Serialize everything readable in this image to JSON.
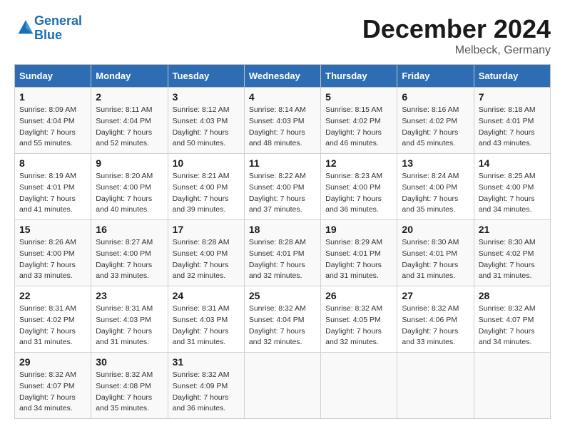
{
  "header": {
    "logo_line1": "General",
    "logo_line2": "Blue",
    "title": "December 2024",
    "subtitle": "Melbeck, Germany"
  },
  "days_of_week": [
    "Sunday",
    "Monday",
    "Tuesday",
    "Wednesday",
    "Thursday",
    "Friday",
    "Saturday"
  ],
  "weeks": [
    [
      {
        "day": "1",
        "sunrise": "8:09 AM",
        "sunset": "4:04 PM",
        "daylight": "7 hours and 55 minutes."
      },
      {
        "day": "2",
        "sunrise": "8:11 AM",
        "sunset": "4:04 PM",
        "daylight": "7 hours and 52 minutes."
      },
      {
        "day": "3",
        "sunrise": "8:12 AM",
        "sunset": "4:03 PM",
        "daylight": "7 hours and 50 minutes."
      },
      {
        "day": "4",
        "sunrise": "8:14 AM",
        "sunset": "4:03 PM",
        "daylight": "7 hours and 48 minutes."
      },
      {
        "day": "5",
        "sunrise": "8:15 AM",
        "sunset": "4:02 PM",
        "daylight": "7 hours and 46 minutes."
      },
      {
        "day": "6",
        "sunrise": "8:16 AM",
        "sunset": "4:02 PM",
        "daylight": "7 hours and 45 minutes."
      },
      {
        "day": "7",
        "sunrise": "8:18 AM",
        "sunset": "4:01 PM",
        "daylight": "7 hours and 43 minutes."
      }
    ],
    [
      {
        "day": "8",
        "sunrise": "8:19 AM",
        "sunset": "4:01 PM",
        "daylight": "7 hours and 41 minutes."
      },
      {
        "day": "9",
        "sunrise": "8:20 AM",
        "sunset": "4:00 PM",
        "daylight": "7 hours and 40 minutes."
      },
      {
        "day": "10",
        "sunrise": "8:21 AM",
        "sunset": "4:00 PM",
        "daylight": "7 hours and 39 minutes."
      },
      {
        "day": "11",
        "sunrise": "8:22 AM",
        "sunset": "4:00 PM",
        "daylight": "7 hours and 37 minutes."
      },
      {
        "day": "12",
        "sunrise": "8:23 AM",
        "sunset": "4:00 PM",
        "daylight": "7 hours and 36 minutes."
      },
      {
        "day": "13",
        "sunrise": "8:24 AM",
        "sunset": "4:00 PM",
        "daylight": "7 hours and 35 minutes."
      },
      {
        "day": "14",
        "sunrise": "8:25 AM",
        "sunset": "4:00 PM",
        "daylight": "7 hours and 34 minutes."
      }
    ],
    [
      {
        "day": "15",
        "sunrise": "8:26 AM",
        "sunset": "4:00 PM",
        "daylight": "7 hours and 33 minutes."
      },
      {
        "day": "16",
        "sunrise": "8:27 AM",
        "sunset": "4:00 PM",
        "daylight": "7 hours and 33 minutes."
      },
      {
        "day": "17",
        "sunrise": "8:28 AM",
        "sunset": "4:00 PM",
        "daylight": "7 hours and 32 minutes."
      },
      {
        "day": "18",
        "sunrise": "8:28 AM",
        "sunset": "4:01 PM",
        "daylight": "7 hours and 32 minutes."
      },
      {
        "day": "19",
        "sunrise": "8:29 AM",
        "sunset": "4:01 PM",
        "daylight": "7 hours and 31 minutes."
      },
      {
        "day": "20",
        "sunrise": "8:30 AM",
        "sunset": "4:01 PM",
        "daylight": "7 hours and 31 minutes."
      },
      {
        "day": "21",
        "sunrise": "8:30 AM",
        "sunset": "4:02 PM",
        "daylight": "7 hours and 31 minutes."
      }
    ],
    [
      {
        "day": "22",
        "sunrise": "8:31 AM",
        "sunset": "4:02 PM",
        "daylight": "7 hours and 31 minutes."
      },
      {
        "day": "23",
        "sunrise": "8:31 AM",
        "sunset": "4:03 PM",
        "daylight": "7 hours and 31 minutes."
      },
      {
        "day": "24",
        "sunrise": "8:31 AM",
        "sunset": "4:03 PM",
        "daylight": "7 hours and 31 minutes."
      },
      {
        "day": "25",
        "sunrise": "8:32 AM",
        "sunset": "4:04 PM",
        "daylight": "7 hours and 32 minutes."
      },
      {
        "day": "26",
        "sunrise": "8:32 AM",
        "sunset": "4:05 PM",
        "daylight": "7 hours and 32 minutes."
      },
      {
        "day": "27",
        "sunrise": "8:32 AM",
        "sunset": "4:06 PM",
        "daylight": "7 hours and 33 minutes."
      },
      {
        "day": "28",
        "sunrise": "8:32 AM",
        "sunset": "4:07 PM",
        "daylight": "7 hours and 34 minutes."
      }
    ],
    [
      {
        "day": "29",
        "sunrise": "8:32 AM",
        "sunset": "4:07 PM",
        "daylight": "7 hours and 34 minutes."
      },
      {
        "day": "30",
        "sunrise": "8:32 AM",
        "sunset": "4:08 PM",
        "daylight": "7 hours and 35 minutes."
      },
      {
        "day": "31",
        "sunrise": "8:32 AM",
        "sunset": "4:09 PM",
        "daylight": "7 hours and 36 minutes."
      },
      null,
      null,
      null,
      null
    ]
  ]
}
